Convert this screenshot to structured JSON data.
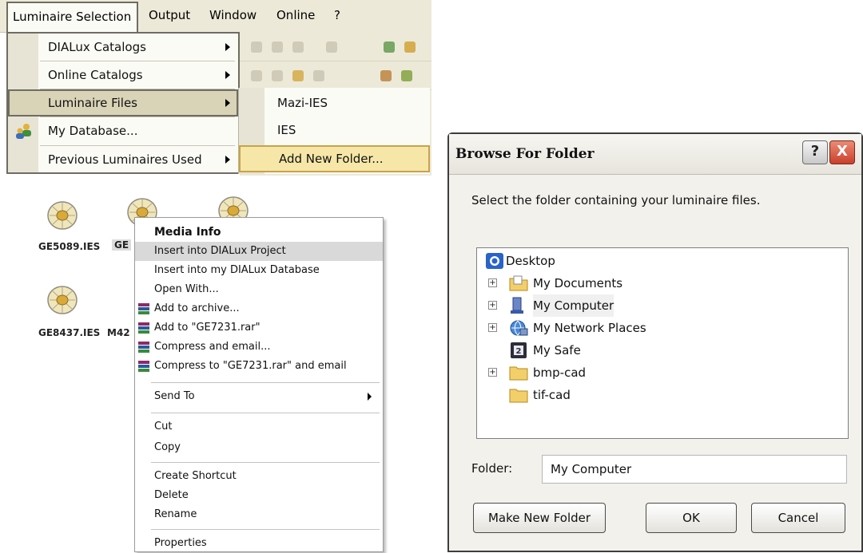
{
  "menubar": {
    "items": [
      {
        "label": "Luminaire Selection"
      },
      {
        "label": "Output"
      },
      {
        "label": "Window"
      },
      {
        "label": "Online"
      },
      {
        "label": "?"
      }
    ]
  },
  "dropdown": {
    "items": [
      {
        "label": "DIALux Catalogs",
        "has_submenu": true
      },
      {
        "label": "Online Catalogs",
        "has_submenu": true
      },
      {
        "label": "Luminaire Files",
        "has_submenu": true,
        "highlighted": true
      },
      {
        "label": "My Database...",
        "has_submenu": false
      },
      {
        "label": "Previous Luminaires Used",
        "has_submenu": true
      }
    ]
  },
  "submenu": {
    "items": [
      {
        "label": "Mazi-IES"
      },
      {
        "label": "IES"
      },
      {
        "label": "Add New Folder...",
        "highlighted": true
      }
    ]
  },
  "files": [
    {
      "label": "GE5089.IES"
    },
    {
      "label": "GE"
    },
    {
      "label": "GE8437.IES"
    },
    {
      "label": "M42"
    }
  ],
  "context_menu": {
    "items": [
      {
        "label": "Media Info"
      },
      {
        "label": "Insert into DIALux Project"
      },
      {
        "label": "Insert into my DIALux Database"
      },
      {
        "label": "Open With..."
      },
      {
        "label": "Add to archive..."
      },
      {
        "label": "Add to \"GE7231.rar\""
      },
      {
        "label": "Compress and email..."
      },
      {
        "label": "Compress to \"GE7231.rar\" and email"
      },
      {
        "label": "Send To"
      },
      {
        "label": "Cut"
      },
      {
        "label": "Copy"
      },
      {
        "label": "Create Shortcut"
      },
      {
        "label": "Delete"
      },
      {
        "label": "Rename"
      },
      {
        "label": "Properties"
      }
    ]
  },
  "dialog": {
    "title": "Browse For Folder",
    "help_label": "?",
    "close_label": "X",
    "instruction": "Select the folder containing your luminaire files.",
    "tree": [
      {
        "label": "Desktop",
        "icon": "desktop-icon"
      },
      {
        "label": "My Documents",
        "icon": "folder-icon"
      },
      {
        "label": "My Computer",
        "icon": "computer-icon",
        "selected": true
      },
      {
        "label": "My Network Places",
        "icon": "network-icon"
      },
      {
        "label": "My Safe",
        "icon": "safe-icon"
      },
      {
        "label": "bmp-cad",
        "icon": "folder-icon"
      },
      {
        "label": "tif-cad",
        "icon": "folder-icon"
      }
    ],
    "folder_label": "Folder:",
    "folder_value": "My Computer",
    "buttons": {
      "make_new_folder": "Make New Folder",
      "ok": "OK",
      "cancel": "Cancel"
    }
  },
  "colors": {
    "menu_bg": "#ece9d8",
    "menu_highlight": "#d9d3b7",
    "submenu_highlight": "#f6e7a8",
    "close_button": "#c9402c"
  }
}
